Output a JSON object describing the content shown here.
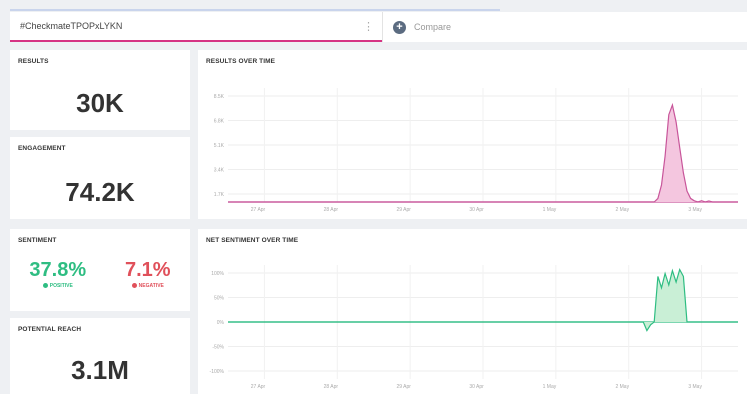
{
  "search": {
    "query": "#CheckmateTPOPxLYKN",
    "menu_icon": "kebab-icon"
  },
  "compare": {
    "label": "Compare",
    "icon": "plus-circle-icon"
  },
  "results": {
    "title": "RESULTS",
    "value": "30K"
  },
  "engagement": {
    "title": "ENGAGEMENT",
    "value": "74.2K"
  },
  "sentiment": {
    "title": "SENTIMENT",
    "positive": {
      "value": "37.8%",
      "label": "POSITIVE"
    },
    "negative": {
      "value": "7.1%",
      "label": "NEGATIVE"
    }
  },
  "reach": {
    "title": "POTENTIAL REACH",
    "value": "3.1M"
  },
  "colors": {
    "accent": "#d63384",
    "positive": "#2ebd82",
    "negative": "#e0505a",
    "results_line": "#c8559a",
    "results_fill": "#f4c6df",
    "sentiment_fill": "#c9efd6"
  },
  "chart_data": [
    {
      "type": "area",
      "title": "RESULTS OVER TIME",
      "x_ticks": [
        "27 Apr",
        "28 Apr",
        "29 Apr",
        "30 Apr",
        "1 May",
        "2 May",
        "3 May"
      ],
      "y_ticks": [
        "8.5K",
        "6.8K",
        "5.1K",
        "3.4K",
        "1.7K"
      ],
      "ylim": [
        0,
        9400
      ],
      "series": [
        {
          "x": [
            0,
            5.8,
            5.85,
            5.9,
            5.95,
            6.0,
            6.05,
            6.1,
            6.15,
            6.2,
            6.25,
            6.3,
            6.35,
            6.4,
            6.45,
            6.5,
            6.55,
            6.6,
            6.65,
            6.75,
            7.0
          ],
          "values": [
            0,
            0,
            0,
            300,
            1400,
            3800,
            7200,
            8000,
            6600,
            4500,
            2400,
            900,
            300,
            100,
            0,
            100,
            0,
            80,
            0,
            0,
            0
          ]
        }
      ]
    },
    {
      "type": "area",
      "title": "NET SENTIMENT OVER TIME",
      "x_ticks": [
        "27 Apr",
        "28 Apr",
        "29 Apr",
        "30 Apr",
        "1 May",
        "2 May",
        "3 May"
      ],
      "y_ticks": [
        "100%",
        "50%",
        "0%",
        "-50%",
        "-100%"
      ],
      "ylim": [
        -100,
        100
      ],
      "series": [
        {
          "x": [
            0,
            5.7,
            5.75,
            5.8,
            5.85,
            5.9,
            5.95,
            6.0,
            6.05,
            6.1,
            6.15,
            6.2,
            6.25,
            6.3,
            6.35,
            6.4,
            6.45,
            7.0
          ],
          "values": [
            0,
            0,
            -15,
            -5,
            0,
            80,
            60,
            85,
            65,
            90,
            70,
            92,
            80,
            0,
            0,
            0,
            0,
            0
          ]
        }
      ]
    }
  ]
}
